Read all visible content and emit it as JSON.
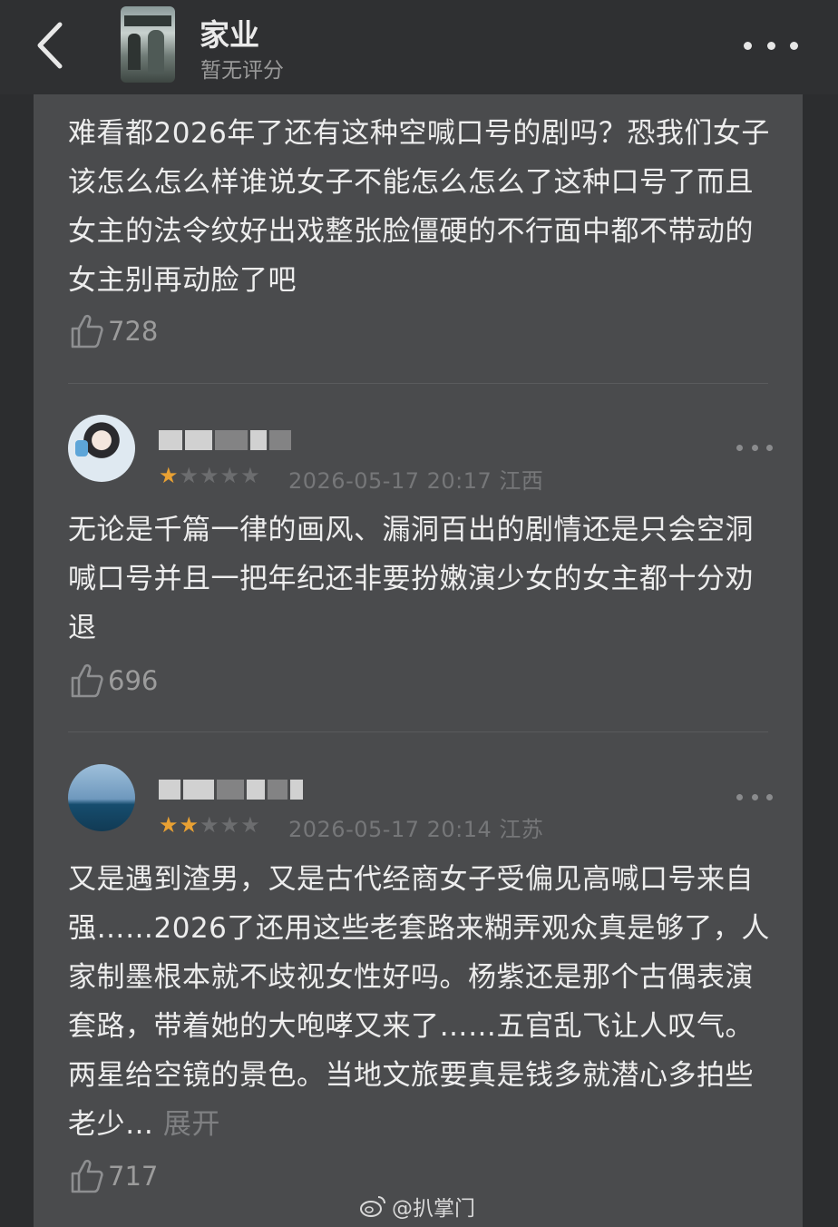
{
  "header": {
    "title": "家业",
    "subtitle": "暂无评分"
  },
  "reviews": [
    {
      "text": "难看都2026年了还有这种空喊口号的剧吗？恐我们女子该怎么怎么样谁说女子不能怎么怎么了这种口号了而且女主的法令纹好出戏整张脸僵硬的不行面中都不带动的女主别再动脸了吧",
      "likes": "728"
    },
    {
      "rating": 1,
      "meta": "2026-05-17 20:17 江西",
      "text": "无论是千篇一律的画风、漏洞百出的剧情还是只会空洞喊口号并且一把年纪还非要扮嫩演少女的女主都十分劝退",
      "likes": "696"
    },
    {
      "rating": 2,
      "meta": "2026-05-17 20:14 江苏",
      "text": "又是遇到渣男，又是古代经商女子受偏见高喊口号来自强……2026了还用这些老套路来糊弄观众真是够了，人家制墨根本就不歧视女性好吗。杨紫还是那个古偶表演套路，带着她的大咆哮又来了……五官乱飞让人叹气。两星给空镜的景色。当地文旅要真是钱多就潜心多拍些老少…",
      "expand": "展开",
      "likes": "717"
    }
  ],
  "watermark": "@扒掌门",
  "colors": {
    "background": "#2c2d2f",
    "card": "#4a4b4d",
    "star_on": "#e9a133",
    "star_off": "#6c6d6f"
  }
}
